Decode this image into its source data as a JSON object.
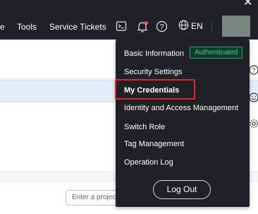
{
  "nav": {
    "partial_item": "e",
    "tools": "Tools",
    "service_tickets": "Service Tickets",
    "lang": "EN",
    "close_glyph": "✕",
    "icons": [
      "terminal-icon",
      "bell-icon",
      "help-icon",
      "globe-icon"
    ],
    "notification_dot_color": "#ff4d4f"
  },
  "menu": {
    "basic_information": "Basic Information",
    "badge": "Authenticated",
    "security_settings": "Security Settings",
    "my_credentials": "My Credentials",
    "identity_access": "Identity and Access Management",
    "switch_role": "Switch Role",
    "tag_management": "Tag Management",
    "operation_log": "Operation Log",
    "logout": "Log Out"
  },
  "page": {
    "project_placeholder": "Enter a project"
  },
  "colors": {
    "nav_bg": "#1f2126",
    "badge_green": "#3fd08a",
    "highlight_red": "#e0262b",
    "row_highlight": "#e2ecfb"
  }
}
